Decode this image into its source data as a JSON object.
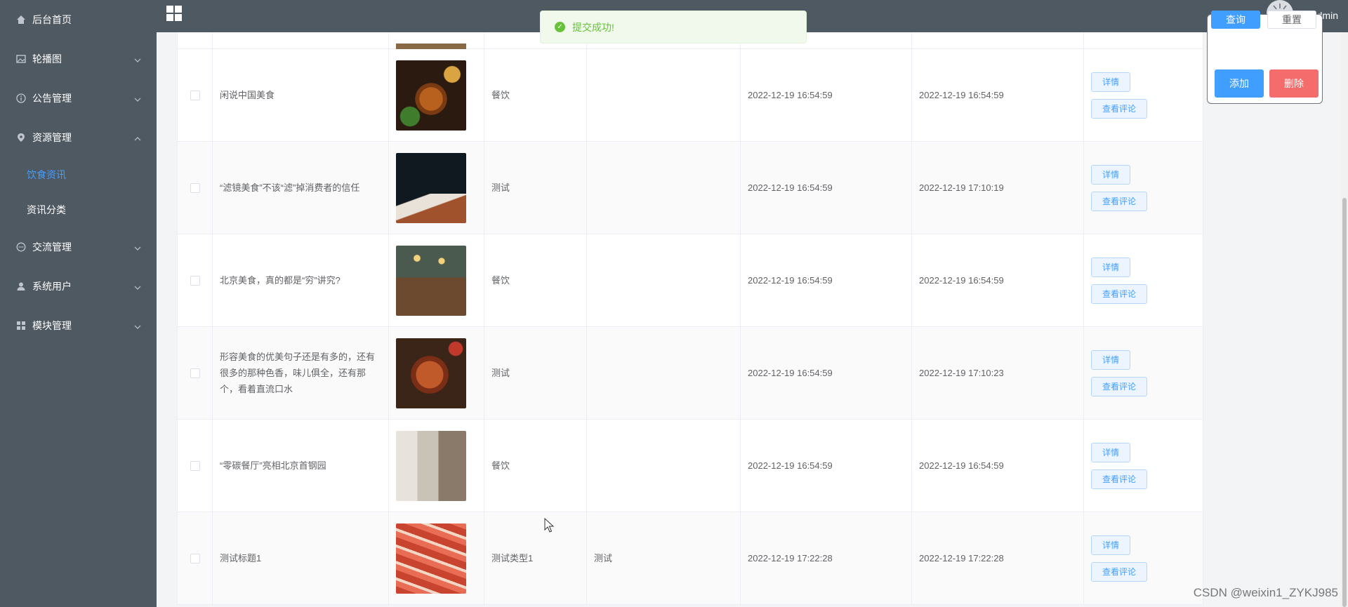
{
  "sidebar": {
    "items": [
      {
        "label": "后台首页",
        "icon": "home-icon"
      },
      {
        "label": "轮播图",
        "icon": "image-icon"
      },
      {
        "label": "公告管理",
        "icon": "info-icon"
      },
      {
        "label": "资源管理",
        "icon": "location-icon"
      },
      {
        "label": "交流管理",
        "icon": "chat-icon"
      },
      {
        "label": "系统用户",
        "icon": "user-icon"
      },
      {
        "label": "模块管理",
        "icon": "grid-icon"
      }
    ],
    "subitems": [
      {
        "label": "饮食资讯",
        "active": true
      },
      {
        "label": "资讯分类",
        "active": false
      }
    ]
  },
  "header": {
    "title": "",
    "username": "admin"
  },
  "toast": {
    "message": "提交成功!"
  },
  "panel": {
    "query": "查询",
    "reset": "重置",
    "add": "添加",
    "delete": "删除"
  },
  "table": {
    "rows": [
      {
        "title": "闲说中国美食",
        "type": "餐饮",
        "extra": "",
        "created": "2022-12-19 16:54:59",
        "updated": "2022-12-19 16:54:59"
      },
      {
        "title": "“滤镜美食”不该“滤”掉消费者的信任",
        "type": "测试",
        "extra": "",
        "created": "2022-12-19 16:54:59",
        "updated": "2022-12-19 17:10:19"
      },
      {
        "title": "北京美食，真的都是“穷”讲究?",
        "type": "餐饮",
        "extra": "",
        "created": "2022-12-19 16:54:59",
        "updated": "2022-12-19 16:54:59"
      },
      {
        "title": "形容美食的优美句子还是有多的，还有很多的那种色香，味儿俱全，还有那个，看着直流口水",
        "type": "测试",
        "extra": "",
        "created": "2022-12-19 16:54:59",
        "updated": "2022-12-19 17:10:23"
      },
      {
        "title": "“零碳餐厅”亮相北京首钢园",
        "type": "餐饮",
        "extra": "",
        "created": "2022-12-19 16:54:59",
        "updated": "2022-12-19 16:54:59"
      },
      {
        "title": "测试标题1",
        "type": "测试类型1",
        "extra": "测试",
        "created": "2022-12-19 17:22:28",
        "updated": "2022-12-19 17:22:28"
      }
    ],
    "detail_label": "详情",
    "comments_label": "查看评论"
  },
  "watermark": "CSDN @weixin1_ZYKJ985"
}
